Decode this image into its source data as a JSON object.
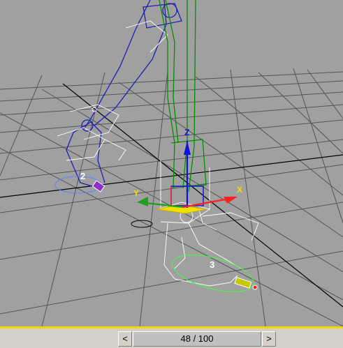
{
  "viewport": {
    "background_color": "#a0a0a0",
    "grid_color": "#555555",
    "axis_labels": {
      "x": "X",
      "y": "Y",
      "z": "Z"
    },
    "axis_colors": {
      "x": "#ff2020",
      "y": "#20a020",
      "z": "#1010e0",
      "gizmo_plane": "#f0e000"
    },
    "object_labels": {
      "left_foot": "2",
      "right_foot": "3"
    },
    "object_colors": {
      "left_leg": "#2020b0",
      "right_leg": "#009000",
      "helpers": "#ffffff",
      "footstep_left": "#6080ff",
      "footstep_right": "#40ff40"
    }
  },
  "timeline": {
    "prev_label": "<",
    "next_label": ">",
    "frame_text": "48 / 100",
    "accent_color": "#f3d600",
    "position": 0.48
  }
}
